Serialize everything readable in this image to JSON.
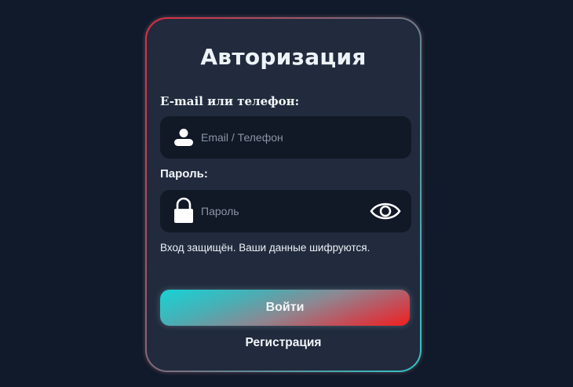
{
  "form": {
    "title": "Авторизация",
    "email_label": "E-mail или телефон:",
    "email_placeholder": "Email / Телефон",
    "email_value": "",
    "password_label": "Пароль:",
    "password_placeholder": "Пароль",
    "password_value": "",
    "security_note": "Вход защищён. Ваши данные шифруются.",
    "login_label": "Войти",
    "register_label": "Регистрация"
  },
  "icons": {
    "email_field": "user-icon",
    "password_field": "lock-icon",
    "password_toggle": "eye-icon"
  },
  "colors": {
    "background": "#111a2b",
    "card": "#212b3d",
    "field": "#111826",
    "accent_cyan": "#17d3d6",
    "accent_red": "#f0201e"
  }
}
